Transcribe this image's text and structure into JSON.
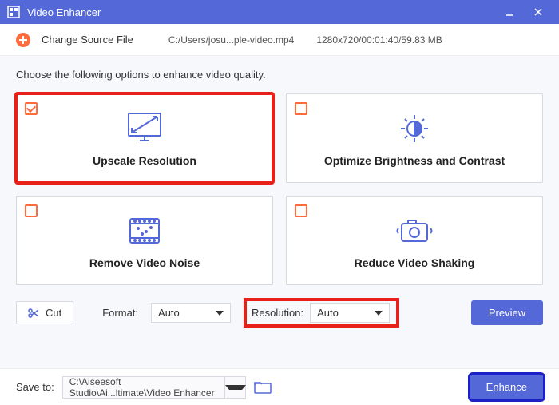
{
  "title": "Video Enhancer",
  "topbar": {
    "change_source": "Change Source File",
    "filepath": "C:/Users/josu...ple-video.mp4",
    "fileinfo": "1280x720/00:01:40/59.83 MB"
  },
  "instruction": "Choose the following options to enhance video quality.",
  "cards": {
    "upscale": {
      "label": "Upscale Resolution",
      "checked": true
    },
    "brightness": {
      "label": "Optimize Brightness and Contrast",
      "checked": false
    },
    "noise": {
      "label": "Remove Video Noise",
      "checked": false
    },
    "shake": {
      "label": "Reduce Video Shaking",
      "checked": false
    }
  },
  "controls": {
    "cut": "Cut",
    "format_label": "Format:",
    "format_value": "Auto",
    "resolution_label": "Resolution:",
    "resolution_value": "Auto",
    "preview": "Preview"
  },
  "bottom": {
    "saveto_label": "Save to:",
    "saveto_path": "C:\\Aiseesoft Studio\\Ai...ltimate\\Video Enhancer",
    "enhance": "Enhance"
  }
}
